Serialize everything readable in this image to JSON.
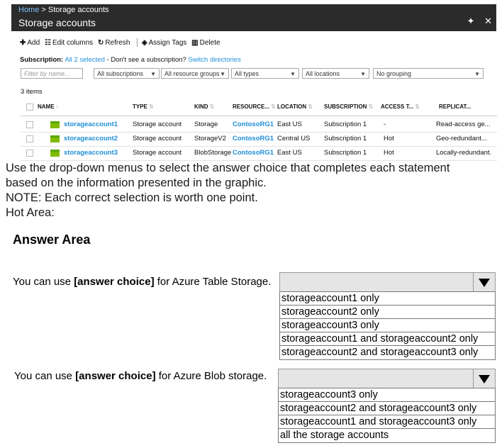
{
  "blade": {
    "breadcrumb_home": "Home",
    "breadcrumb_sep": " > ",
    "breadcrumb_current": "Storage accounts",
    "title": "Storage accounts",
    "pin_glyph": "✦",
    "close_glyph": "✕"
  },
  "toolbar": {
    "add_label": "Add",
    "edit_columns_label": "Edit columns",
    "refresh_label": "Refresh",
    "assign_tags_label": "Assign Tags",
    "delete_label": "Delete"
  },
  "subscription_line": {
    "label": "Subscription:",
    "selected": "All 2 selected",
    "question": " - Don't see a subscription? ",
    "switch_link": "Switch directories"
  },
  "filters": {
    "search_placeholder": "Filter by name...",
    "subscriptions": "All subscriptions",
    "resource_groups": "All resource groups",
    "types": "All types",
    "locations": "All locations",
    "grouping": "No grouping"
  },
  "item_count": "3 items",
  "table": {
    "columns": [
      "NAME",
      "TYPE",
      "KIND",
      "RESOURCE...",
      "LOCATION",
      "SUBSCRIPTION",
      "ACCESS T...",
      "REPLICAT..."
    ],
    "rows": [
      {
        "name": "storageaccount1",
        "type": "Storage account",
        "kind": "Storage",
        "resource_group": "ContosoRG1",
        "location": "East US",
        "subscription": "Subscription 1",
        "access_tier": "-",
        "replication": "Read-access ge..."
      },
      {
        "name": "storageaccount2",
        "type": "Storage account",
        "kind": "StorageV2",
        "resource_group": "ContosoRG1",
        "location": "Central US",
        "subscription": "Subscription 1",
        "access_tier": "Hot",
        "replication": "Geo-redundant..."
      },
      {
        "name": "storageaccount3",
        "type": "Storage account",
        "kind": "BlobStorage",
        "resource_group": "ContosoRG1",
        "location": "East US",
        "subscription": "Subscription 1",
        "access_tier": "Hot",
        "replication": "Locally-redundant."
      }
    ]
  },
  "question": {
    "line1": "Use the drop-down menus to select the answer choice that completes each statement",
    "line2": "based on the information presented in the graphic.",
    "note": "NOTE: Each correct selection is worth one point.",
    "hot_area": "Hot Area:"
  },
  "answer_area": {
    "title": "Answer Area",
    "statements": [
      {
        "prefix": "You can use ",
        "bold": "[answer choice]",
        "suffix": " for Azure Table Storage.",
        "options": [
          "storageaccount1 only",
          "storageaccount2 only",
          "storageaccount3 only",
          "storageaccount1 and storageaccount2 only",
          "storageaccount2 and storageaccount3 only"
        ]
      },
      {
        "prefix": "You can use ",
        "bold": "[answer choice]",
        "suffix": " for Azure Blob storage.",
        "options": [
          "storageaccount3 only",
          "storageaccount2 and storageaccount3 only",
          "storageaccount1 and storageaccount3 only",
          "all the storage accounts"
        ]
      }
    ]
  },
  "colors": {
    "header_bg": "#2b2b2b",
    "link": "#1f8fd8",
    "storage_icon": "#7fba00"
  }
}
